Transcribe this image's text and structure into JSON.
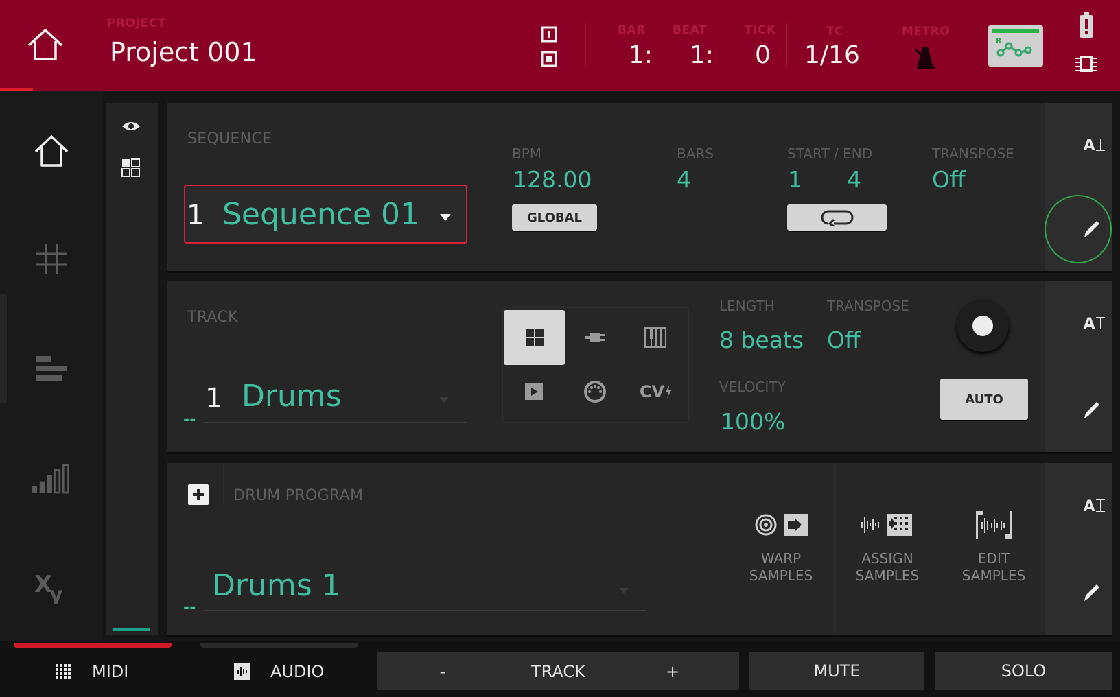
{
  "header": {
    "project_label": "PROJECT",
    "project_name": "Project 001",
    "bar_label": "BAR",
    "beat_label": "BEAT",
    "tick_label": "TICK",
    "tc_label": "TC",
    "metro_label": "METRO",
    "bar_value": "1:",
    "beat_value": "1:",
    "tick_value": "0",
    "tc_value": "1/16",
    "status_indicator_text": "R"
  },
  "sequence": {
    "section_label": "SEQUENCE",
    "number": "1",
    "name": "Sequence 01",
    "bpm_label": "BPM",
    "bpm_value": "128.00",
    "global_button": "GLOBAL",
    "bars_label": "BARS",
    "bars_value": "4",
    "start_end_label": "START / END",
    "start_value": "1",
    "end_value": "4",
    "transpose_label": "TRANSPOSE",
    "transpose_value": "Off"
  },
  "track": {
    "section_label": "TRACK",
    "number": "1",
    "name": "Drums",
    "dash": "--",
    "length_label": "LENGTH",
    "length_value": "8 beats",
    "transpose_label": "TRANSPOSE",
    "transpose_value": "Off",
    "velocity_label": "VELOCITY",
    "velocity_value": "100%",
    "auto_button": "AUTO",
    "cv_label": "CV"
  },
  "program": {
    "section_label": "DRUM PROGRAM",
    "name": "Drums 1",
    "dash": "--",
    "warp_label_1": "WARP",
    "warp_label_2": "SAMPLES",
    "assign_label_1": "ASSIGN",
    "assign_label_2": "SAMPLES",
    "edit_label_1": "EDIT",
    "edit_label_2": "SAMPLES"
  },
  "panel_ai_label": "A",
  "bottombar": {
    "midi": "MIDI",
    "audio": "AUDIO",
    "track_minus": "-",
    "track": "TRACK",
    "track_plus": "+",
    "mute": "MUTE",
    "solo": "SOLO"
  },
  "colors": {
    "header_bg": "#8b0025",
    "accent_teal": "#3fbfa0",
    "accent_red": "#e0202a",
    "highlight_green": "#2ea84a"
  }
}
